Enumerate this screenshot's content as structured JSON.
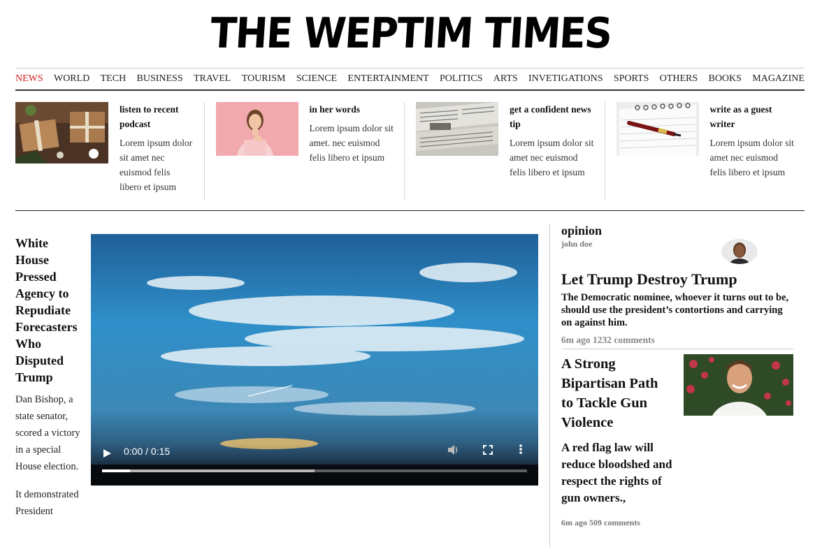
{
  "site": {
    "logo": "THE WEPTIM TIMES"
  },
  "nav": {
    "items": [
      "NEWS",
      "WORLD",
      "TECH",
      "BUSINESS",
      "TRAVEL",
      "TOURISM",
      "SCIENCE",
      "ENTERTAINMENT",
      "POLITICS",
      "ARTS",
      "INVETIGATIONS",
      "SPORTS",
      "OTHERS",
      "BOOKS",
      "MAGAZINE"
    ],
    "active": "NEWS",
    "active_color": "#d42020"
  },
  "promos": [
    {
      "title": "listen to recent podcast",
      "desc": "Lorem ipsum dolor sit amet nec euismod felis libero et ipsum",
      "image": "gift-boxes-photo"
    },
    {
      "title": "in her words",
      "desc": "Lorem ipsum dolor sit amet. nec euismod felis libero et ipsum",
      "image": "woman-portrait-photo"
    },
    {
      "title": "get a confident news tip",
      "desc": "Lorem ipsum dolor sit amet nec euismod felis libero et ipsum",
      "image": "newspapers-photo"
    },
    {
      "title": "write as a guest writer",
      "desc": "Lorem ipsum dolor sit amet nec euismod felis libero et ipsum",
      "image": "pen-notebook-photo"
    }
  ],
  "lead": {
    "headline": "White House Pressed Agency to Repudiate Forecasters Who Disputed Trump",
    "paragraphs": [
      "Dan Bishop, a state senator, scored a victory in a special House election.",
      "It demonstrated President"
    ]
  },
  "video": {
    "time": "0:00 / 0:15",
    "played_fraction": 0.066,
    "buffered_fraction": 0.5
  },
  "opinion": {
    "label": "opinion",
    "author": "john doe",
    "title": "Let Trump Destroy Trump",
    "summary": "The Democratic nominee, whoever it turns out to be, should use the president’s contortions and carrying on against him.",
    "meta": "6m ago 1232 comments"
  },
  "story2": {
    "title": "A Strong Bipartisan Path to Tackle Gun Violence",
    "summary": "A red flag law will reduce bloodshed and respect the rights of gun owners.,",
    "meta": "6m ago 509 comments"
  }
}
